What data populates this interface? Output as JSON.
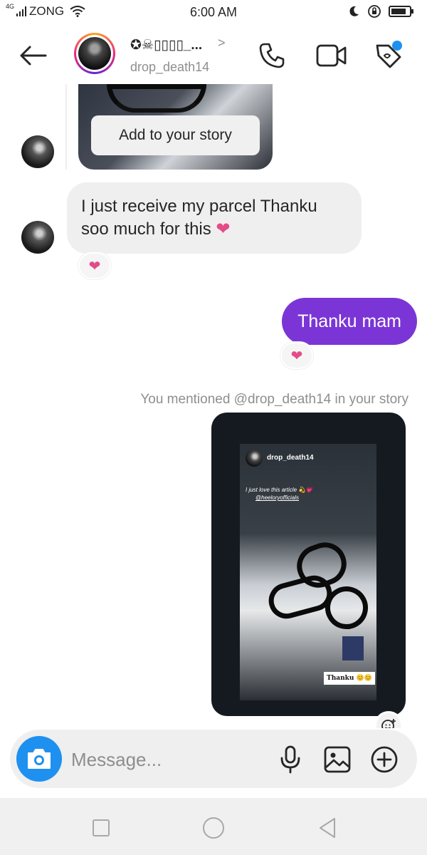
{
  "status_bar": {
    "network": "4G",
    "carrier": "ZONG",
    "time": "6:00 AM",
    "icons": [
      "signal-icon",
      "wifi-icon",
      "moon-icon",
      "rotation-lock-icon",
      "battery-icon"
    ]
  },
  "header": {
    "contact_name": "✪☠▯▯▯▯_...",
    "username": "drop_death14",
    "chevron": ">",
    "icons": [
      "back-arrow-icon",
      "phone-icon",
      "video-camera-icon",
      "tag-icon"
    ],
    "accent_dot_color": "#1e90f0"
  },
  "messages": {
    "shared_post_action": "Add to your story",
    "incoming_text": "I just receive my parcel Thanku soo much for this",
    "incoming_emoji": "❤",
    "outgoing_text": "Thanku mam",
    "reaction_emoji": "❤",
    "mention_note": "You mentioned @drop_death14 in your story"
  },
  "story_share": {
    "username": "drop_death14",
    "caption_line1": "I just love this article 💫💗",
    "caption_line2": "@heeloryofficials",
    "tag_text": "Thanku 😊😊"
  },
  "composer": {
    "placeholder": "Message...",
    "icons": [
      "camera-icon",
      "microphone-icon",
      "gallery-icon",
      "plus-icon"
    ]
  },
  "navbar": {
    "icons": [
      "recents-square-icon",
      "home-circle-icon",
      "back-triangle-icon"
    ]
  },
  "colors": {
    "outgoing_bubble": "#7b35d6",
    "incoming_bubble": "#efefef",
    "heart": "#e24c88",
    "camera_button": "#1e90f0"
  }
}
